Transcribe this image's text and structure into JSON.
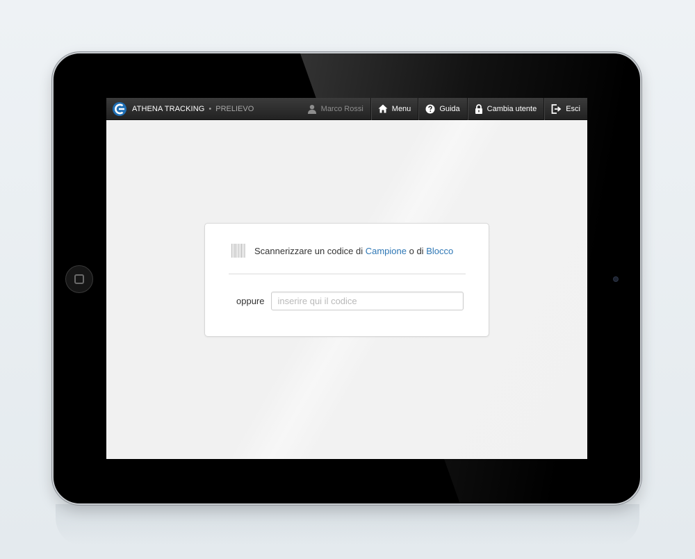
{
  "app": {
    "name": "ATHENA TRACKING",
    "separator": "•",
    "section": "PRELIEVO"
  },
  "nav": {
    "user_name": "Marco Rossi",
    "menu_label": "Menu",
    "help_label": "Guida",
    "switch_user_label": "Cambia utente",
    "exit_label": "Esci"
  },
  "scan": {
    "prompt_text": "Scannerizzare un codice di",
    "sample_link": "Campione",
    "connector": "o di",
    "block_link": "Blocco",
    "or_label": "oppure",
    "input_placeholder": "inserire qui il codice",
    "input_value": ""
  },
  "icons": {
    "logo": "athena-logo-icon",
    "user": "user-icon",
    "menu": "home-icon",
    "help": "question-circle-icon",
    "switch_user": "lock-icon",
    "exit": "sign-out-icon",
    "scan": "barcode-icon"
  },
  "colors": {
    "accent_link": "#2e77b5",
    "topbar": "#2c2c2c",
    "logo_blue": "#1f6fb5"
  }
}
